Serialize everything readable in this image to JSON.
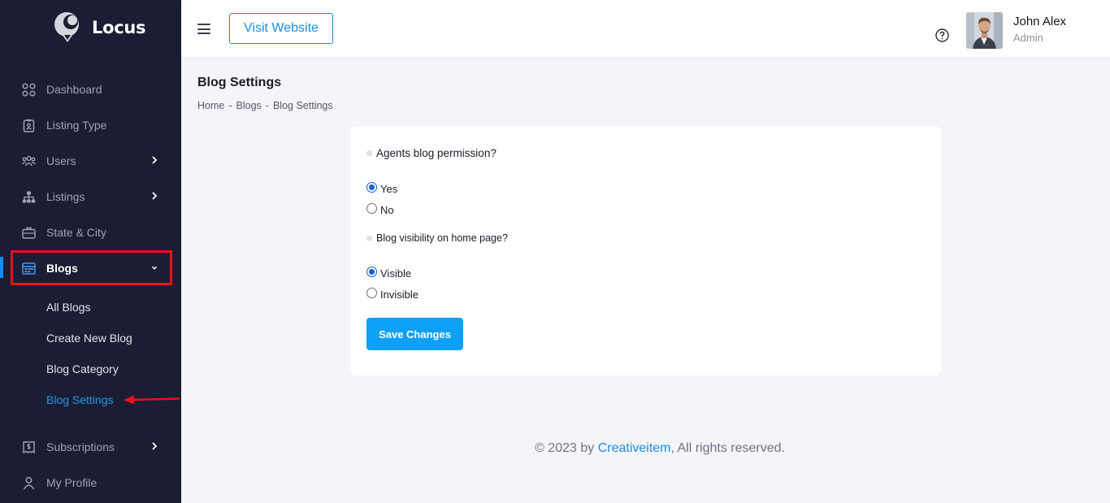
{
  "brand": {
    "name": "Locus"
  },
  "sidebar": {
    "items": [
      {
        "label": "Dashboard",
        "icon": "grid-icon"
      },
      {
        "label": "Listing Type",
        "icon": "clipboard-icon"
      },
      {
        "label": "Users",
        "icon": "users-icon",
        "has_children": true
      },
      {
        "label": "Listings",
        "icon": "sitemap-icon",
        "has_children": true
      },
      {
        "label": "State & City",
        "icon": "briefcase-icon"
      },
      {
        "label": "Blogs",
        "icon": "calendar-icon",
        "has_children": true,
        "expanded": true,
        "active": true
      },
      {
        "label": "Subscriptions",
        "icon": "receipt-icon",
        "has_children": true
      },
      {
        "label": "My Profile",
        "icon": "user-icon"
      }
    ],
    "blog_submenu": [
      "All Blogs",
      "Create New Blog",
      "Blog Category",
      "Blog Settings"
    ],
    "current_subitem": "Blog Settings"
  },
  "header": {
    "visit_label": "Visit Website",
    "user": {
      "name": "John Alex",
      "role": "Admin"
    }
  },
  "page": {
    "title": "Blog Settings",
    "breadcrumb": [
      "Home",
      "Blogs",
      "Blog Settings"
    ]
  },
  "form": {
    "q1": {
      "label": "Agents blog permission?",
      "options": [
        {
          "label": "Yes",
          "checked": true
        },
        {
          "label": "No",
          "checked": false
        }
      ]
    },
    "q2": {
      "label": "Blog visibility on home page?",
      "options": [
        {
          "label": "Visible",
          "checked": true
        },
        {
          "label": "Invisible",
          "checked": false
        }
      ]
    },
    "save_label": "Save Changes"
  },
  "footer": {
    "prefix": "© 2023 by ",
    "link": "Creativeitem",
    "suffix": ", All rights reserved."
  },
  "colors": {
    "sidebar_bg": "#1a1d33",
    "accent": "#0ea0f8",
    "link": "#1a8fe0",
    "highlight": "#e8111a"
  }
}
